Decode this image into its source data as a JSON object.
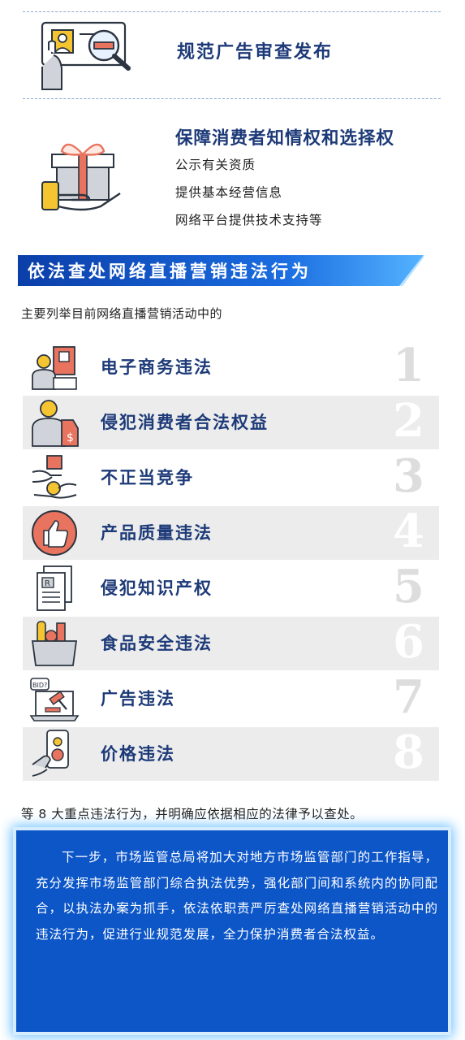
{
  "section_one": {
    "title": "规范广告审查发布",
    "icon": "ad-review-icon"
  },
  "section_two": {
    "title": "保障消费者知情权和选择权",
    "icon": "gift-hand-icon",
    "lines": [
      "公示有关资质",
      "提供基本经营信息",
      "网络平台提供技术支持等"
    ]
  },
  "banner": {
    "title": "依法查处网络直播营销违法行为"
  },
  "intro": "主要列举目前网络直播营销活动中的",
  "violations": [
    {
      "label": "电子商务违法",
      "number": "1",
      "icon": "ecommerce-icon"
    },
    {
      "label": "侵犯消费者合法权益",
      "number": "2",
      "icon": "consumer-rights-icon"
    },
    {
      "label": "不正当竞争",
      "number": "3",
      "icon": "competition-icon"
    },
    {
      "label": "产品质量违法",
      "number": "4",
      "icon": "quality-thumbs-up-icon"
    },
    {
      "label": "侵犯知识产权",
      "number": "5",
      "icon": "trademark-document-icon"
    },
    {
      "label": "食品安全违法",
      "number": "6",
      "icon": "grocery-bag-icon"
    },
    {
      "label": "广告违法",
      "number": "7",
      "icon": "auction-laptop-icon"
    },
    {
      "label": "价格违法",
      "number": "8",
      "icon": "price-phone-icon"
    }
  ],
  "closing": "等 8 大重点违法行为，并明确应依据相应的法律予以查处。",
  "summary": "下一步，市场监管总局将加大对地方市场监管部门的工作指导，充分发挥市场监管部门综合执法优势，强化部门间和系统内的协同配合，以执法办案为抓手，依法依职责严厉查处网络直播营销活动中的违法行为，促进行业规范发展，全力保护消费者合法权益。",
  "colors": {
    "navy": "#1d3a78",
    "banner_blue": "#0c56c8",
    "accent_red": "#e8735e",
    "accent_yellow": "#f4c531"
  }
}
